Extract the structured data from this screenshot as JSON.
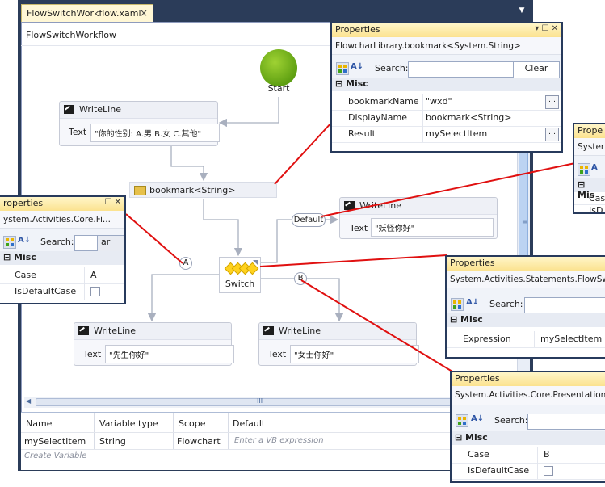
{
  "designer": {
    "tab_title": "FlowSwitchWorkflow.xaml",
    "breadcrumb": "FlowSwitchWorkflow",
    "start_label": "Start",
    "writeline_title": "WriteLine",
    "text_label": "Text",
    "writeline_main_text": "\"你的性别: A.男 B.女 C.其他\"",
    "bookmark_label": "bookmark<String>",
    "switch_label": "Switch",
    "default_case_label": "Default",
    "case_a_label": "A",
    "case_b_label": "B",
    "writeline_default_text": "\"妖怪你好\"",
    "writeline_a_text": "\"先生你好\"",
    "writeline_b_text": "\"女士你好\"",
    "hscroll_grip": "III",
    "vscroll_grip": "≡"
  },
  "variables": {
    "headers": [
      "Name",
      "Variable type",
      "Scope",
      "Default"
    ],
    "row": {
      "name": "mySelectItem",
      "type": "String",
      "scope": "Flowchart",
      "default_placeholder": "Enter a VB expression"
    },
    "create_label": "Create Variable"
  },
  "panel_bookmark": {
    "title": "Properties",
    "type_name": "FlowcharLibrary.bookmark<System.String>",
    "search_label": "Search:",
    "clear_label": "Clear",
    "category": "Misc",
    "rows": [
      {
        "key": "bookmarkName",
        "value": "\"wxd\""
      },
      {
        "key": "DisplayName",
        "value": "bookmark<String>"
      },
      {
        "key": "Result",
        "value": "mySelectItem"
      }
    ]
  },
  "panel_case_a": {
    "title": "roperties",
    "type_name": "ystem.Activities.Core.Fi...",
    "search_label": "Search:",
    "search_tail": "ar",
    "category": "Misc",
    "rows": [
      {
        "key": "Case",
        "value": "A"
      },
      {
        "key": "IsDefaultCase",
        "value": ""
      }
    ]
  },
  "panel_default": {
    "title": "Prope",
    "type_name": "Syster",
    "category": "Mis",
    "rows": [
      {
        "key": "Cas",
        "value": ""
      },
      {
        "key": "IsD",
        "value": ""
      }
    ]
  },
  "panel_switch": {
    "title": "Properties",
    "type_name": "System.Activities.Statements.FlowSw",
    "search_label": "Search:",
    "category": "Misc",
    "rows": [
      {
        "key": "Expression",
        "value": "mySelectItem"
      }
    ]
  },
  "panel_case_b": {
    "title": "Properties",
    "type_name": "System.Activities.Core.Presentation.",
    "search_label": "Search:",
    "category": "Misc",
    "rows": [
      {
        "key": "Case",
        "value": "B"
      },
      {
        "key": "IsDefaultCase",
        "value": ""
      }
    ]
  },
  "colors": {
    "chrome": "#2b3c59",
    "callout_line": "#e01010",
    "connector": "#a9b0bf",
    "panel_title": "#fbe28f"
  }
}
